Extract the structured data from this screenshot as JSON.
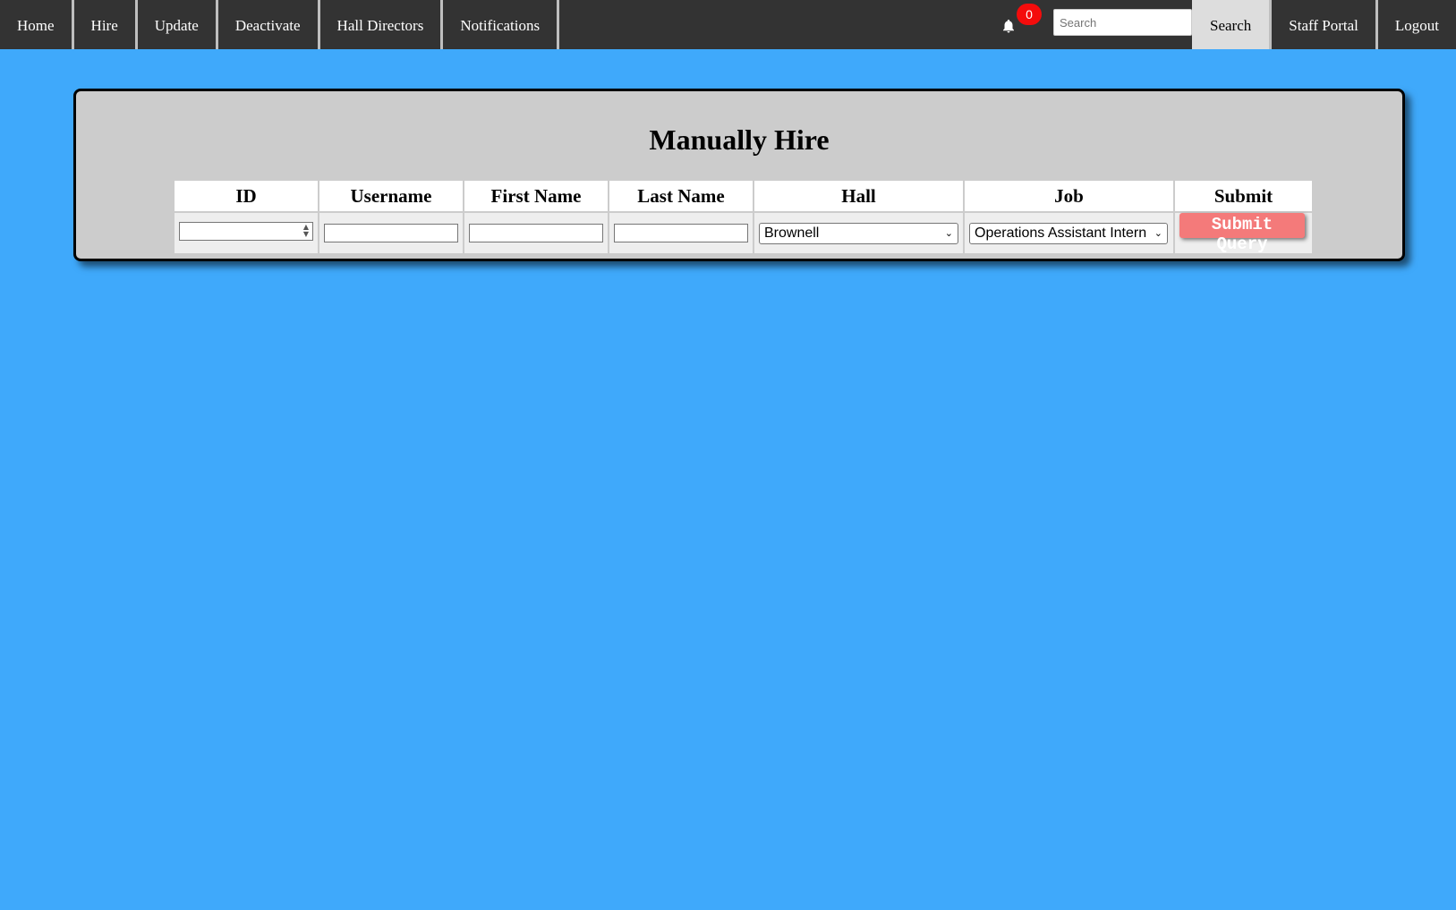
{
  "nav": {
    "home": "Home",
    "hire": "Hire",
    "update": "Update",
    "deactivate": "Deactivate",
    "hall_directors": "Hall Directors",
    "notifications": "Notifications",
    "notification_count": "0",
    "search_placeholder": "Search",
    "search_button": "Search",
    "staff_portal": "Staff Portal",
    "logout": "Logout"
  },
  "panel": {
    "title": "Manually Hire",
    "headers": [
      "ID",
      "Username",
      "First Name",
      "Last Name",
      "Hall",
      "Job",
      "Submit"
    ],
    "hall_selected": "Brownell",
    "job_selected": "Operations Assistant Intern",
    "submit_label": "Submit Query"
  },
  "colors": {
    "background": "#3fa9fb",
    "navbar": "#333333",
    "badge": "#f40c0c",
    "submit": "#f47a7a"
  },
  "icons": {
    "bell": "bell-icon"
  }
}
